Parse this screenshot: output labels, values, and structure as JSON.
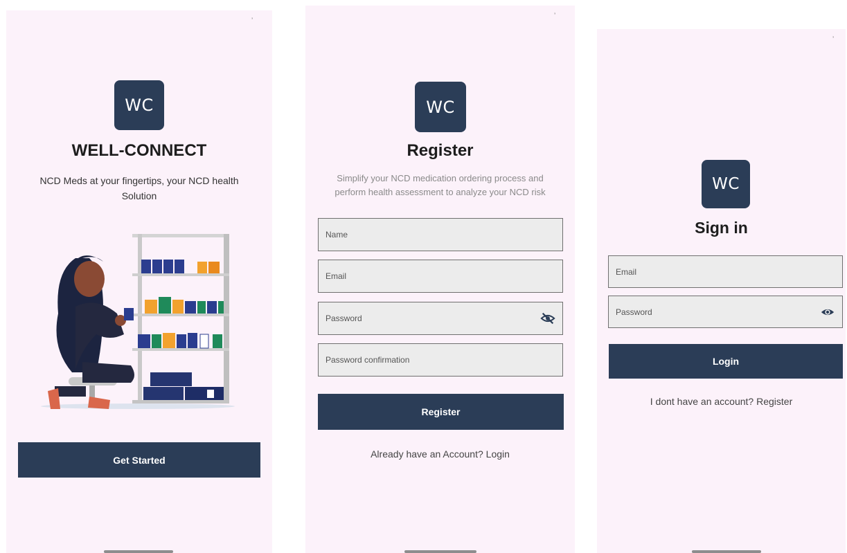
{
  "welcome": {
    "logo_text": "WC",
    "title": "WELL-CONNECT",
    "subtitle_line1": "NCD Meds at your fingertips, your NCD health",
    "subtitle_line2": "Solution",
    "button_label": "Get Started"
  },
  "register": {
    "logo_text": "WC",
    "title": "Register",
    "subtitle_line1": "Simplify your NCD medication ordering process and",
    "subtitle_line2": "perform health assessment to analyze your NCD risk",
    "fields": {
      "name": "Name",
      "email": "Email",
      "password": "Password",
      "password_confirmation": "Password confirmation"
    },
    "button_label": "Register",
    "login_link": "Already have an Account? Login"
  },
  "signin": {
    "logo_text": "WC",
    "title": "Sign in",
    "fields": {
      "email": "Email",
      "password": "Password"
    },
    "button_label": "Login",
    "register_link": "I dont have an account? Register"
  },
  "icons": {
    "password_hidden": "eye-off-icon",
    "password_visible": "eye-icon"
  },
  "colors": {
    "primary": "#2b3d57",
    "background": "#fcf2fa",
    "field": "#ececec"
  }
}
